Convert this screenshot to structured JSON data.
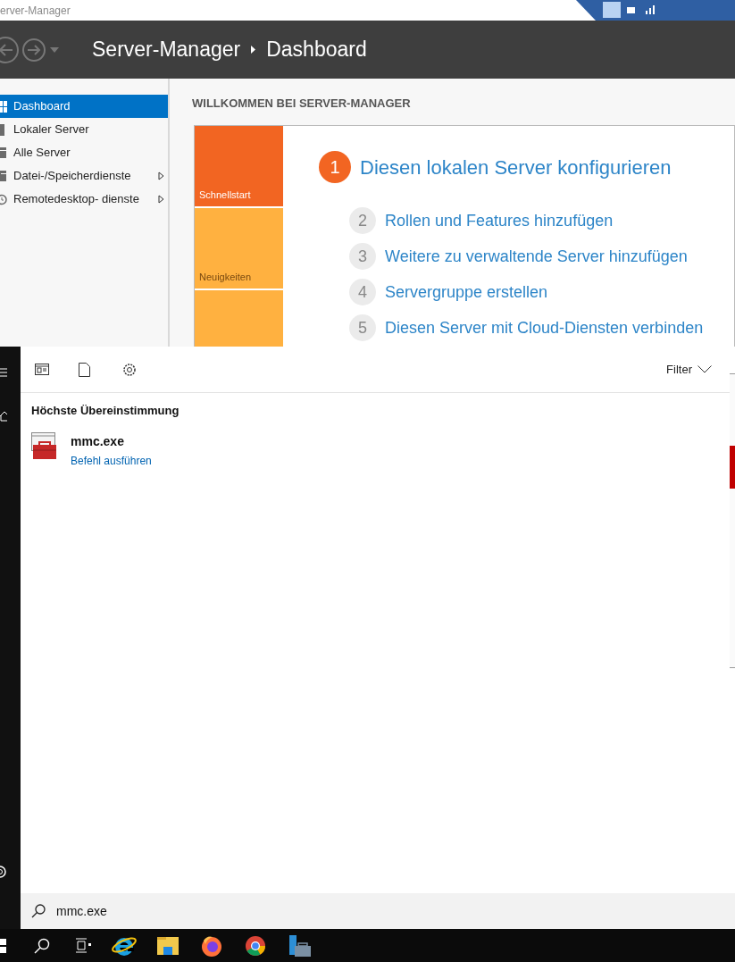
{
  "window": {
    "title": "erver-Manager"
  },
  "header": {
    "app": "Server-Manager",
    "page": "Dashboard"
  },
  "sidebar": {
    "items": [
      {
        "label": "Dashboard",
        "kind": "dashboard",
        "selected": true,
        "has_submenu": false
      },
      {
        "label": "Lokaler Server",
        "kind": "server",
        "selected": false,
        "has_submenu": false
      },
      {
        "label": "Alle Server",
        "kind": "servers",
        "selected": false,
        "has_submenu": false
      },
      {
        "label": "Datei-/Speicherdienste",
        "kind": "storage",
        "selected": false,
        "has_submenu": true
      },
      {
        "label": "Remotedesktop- dienste",
        "kind": "remote",
        "selected": false,
        "has_submenu": true
      }
    ]
  },
  "welcome": {
    "heading": "WILLKOMMEN BEI SERVER-MANAGER",
    "tiles": [
      {
        "label": "Schnellstart",
        "selected": true
      },
      {
        "label": "Neuigkeiten",
        "selected": false
      },
      {
        "selected": false
      }
    ],
    "steps": [
      {
        "number": "1",
        "label": "Diesen lokalen Server konfigurieren",
        "current": true
      },
      {
        "number": "2",
        "label": "Rollen und Features hinzufügen",
        "current": false
      },
      {
        "number": "3",
        "label": "Weitere zu verwaltende Server hinzufügen",
        "current": false
      },
      {
        "number": "4",
        "label": "Servergruppe erstellen",
        "current": false
      },
      {
        "number": "5",
        "label": "Diesen Server mit Cloud-Diensten verbinden",
        "current": false
      }
    ]
  },
  "search_panel": {
    "filter": "Filter",
    "section": "Höchste Übereinstimmung",
    "results": [
      {
        "name": "mmc.exe",
        "action": "Befehl ausführen"
      }
    ],
    "query": "mmc.exe"
  },
  "taskbar": {
    "apps": [
      {
        "kind": "ie"
      },
      {
        "kind": "explorer"
      },
      {
        "kind": "firefox"
      },
      {
        "kind": "chrome"
      },
      {
        "kind": "servermanager"
      }
    ]
  }
}
